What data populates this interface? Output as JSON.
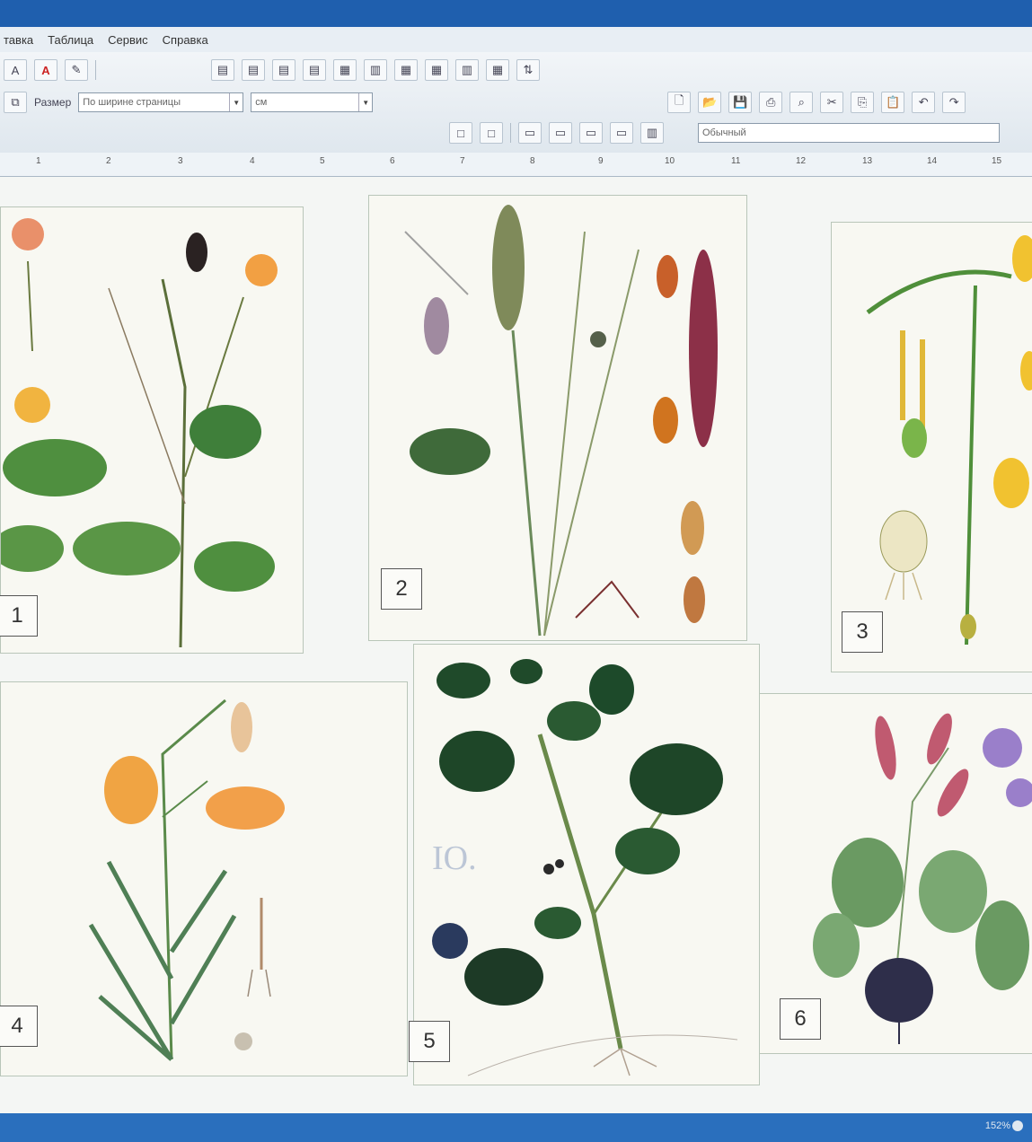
{
  "menu": {
    "items": [
      "тавка",
      "Таблица",
      "Сервис",
      "Справка"
    ]
  },
  "toolbar": {
    "size_label": "Размер",
    "fit_select": "По ширине страницы",
    "unit_select": "см",
    "style_select": "Обычный"
  },
  "ruler": {
    "ticks": [
      "1",
      "2",
      "3",
      "4",
      "5",
      "6",
      "7",
      "8",
      "9",
      "10",
      "11",
      "12",
      "13",
      "14",
      "15"
    ]
  },
  "panels": [
    {
      "number": "1",
      "plant": "yellow-flowered crucifer"
    },
    {
      "number": "2",
      "plant": "cereal grass"
    },
    {
      "number": "3",
      "plant": "yellow bulbous plant"
    },
    {
      "number": "4",
      "plant": "orange lily"
    },
    {
      "number": "5",
      "plant": "black nightshade"
    },
    {
      "number": "6",
      "plant": "radish"
    }
  ],
  "status": {
    "zoom": "152%"
  },
  "colors": {
    "title_blue": "#1f5fae",
    "status_blue": "#2a6fbd",
    "leaf_green": "#3f7f3a",
    "paper": "#f8f8f2"
  }
}
